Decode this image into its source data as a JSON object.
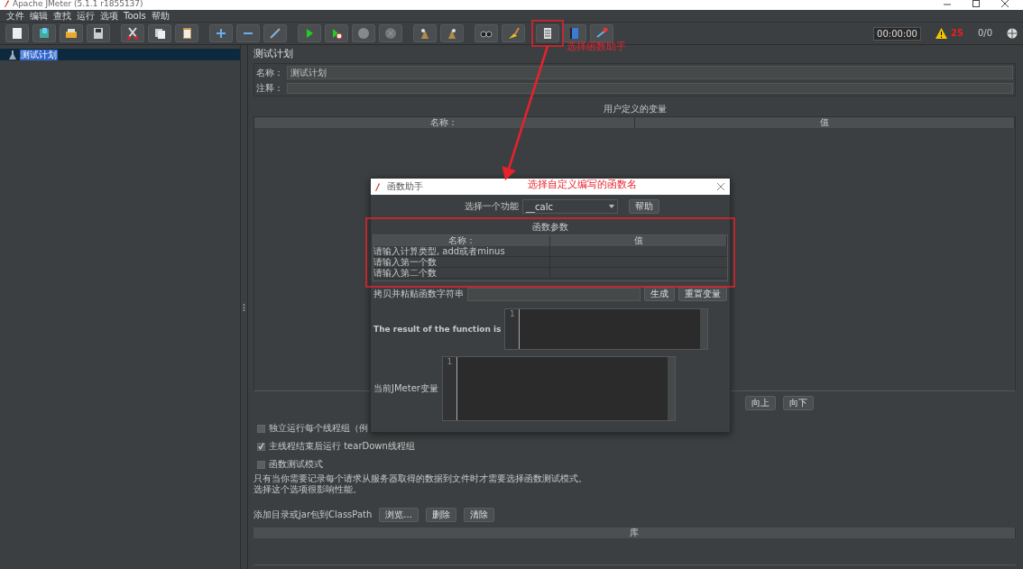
{
  "window": {
    "title": "Apache JMeter (5.1.1 r1855137)"
  },
  "menu": [
    {
      "label": "文件"
    },
    {
      "label": "编辑"
    },
    {
      "label": "查找"
    },
    {
      "label": "运行"
    },
    {
      "label": "选项"
    },
    {
      "label": "Tools"
    },
    {
      "label": "帮助"
    }
  ],
  "toolbar": {
    "timer": "00:00:00",
    "warnings": "25",
    "threads": "0/0"
  },
  "tree": {
    "items": [
      {
        "label": "测试计划",
        "selected": true
      }
    ]
  },
  "test_plan": {
    "heading": "测试计划",
    "name_label": "名称：",
    "name_value": "测试计划",
    "comment_label": "注释：",
    "variables_title": "用户定义的变量",
    "variables_columns": [
      "名称：",
      "值"
    ],
    "buttons": [
      "向上",
      "向下"
    ],
    "options": [
      {
        "label": "独立运行每个线程组（例",
        "checked": false
      },
      {
        "label": "主线程结束后运行 tearDown线程组",
        "checked": true
      },
      {
        "label": "函数测试模式",
        "checked": false
      }
    ],
    "note": [
      "只有当你需要记录每个请求从服务器取得的数据到文件时才需要选择函数测试模式。",
      "选择这个选项很影响性能。"
    ],
    "classpath_label": "添加目录或jar包到ClassPath",
    "classpath_buttons": [
      "浏览...",
      "删除",
      "清除"
    ],
    "library_columns": [
      "库"
    ]
  },
  "dialog": {
    "title": "函数助手",
    "function_label": "选择一个功能",
    "function_value": "__calc",
    "help_button": "帮助",
    "params_title": "函数参数",
    "params_columns": [
      "名称：",
      "值"
    ],
    "params_rows": [
      {
        "name": "请输入计算类型, add或者minus"
      },
      {
        "name": "请输入第一个数"
      },
      {
        "name": "请输入第二个数"
      }
    ],
    "copy_label": "拷贝并粘贴函数字符串",
    "generate_button": "生成",
    "reset_button": "重置变量",
    "result_label": "The result of the function is",
    "result_line": "1",
    "vars_label": "当前JMeter变量",
    "vars_line": "1"
  },
  "annotations": [
    {
      "text": "选择函数助手"
    },
    {
      "text": "选择自定义编写的函数名"
    }
  ]
}
